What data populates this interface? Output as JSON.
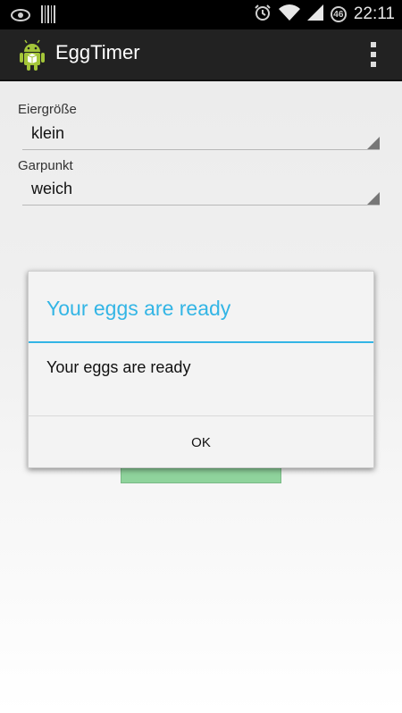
{
  "status_bar": {
    "time": "22:11",
    "network_badge": "46",
    "icons": [
      "eye-icon",
      "barcode-icon",
      "alarm-icon",
      "wifi-icon",
      "signal-icon"
    ]
  },
  "action_bar": {
    "title": "EggTimer",
    "app_icon": "android-robot-icon",
    "overflow_icon": "overflow-menu-icon"
  },
  "form": {
    "size_label": "Eiergröße",
    "size_value": "klein",
    "doneness_label": "Garpunkt",
    "doneness_value": "weich"
  },
  "dialog": {
    "title": "Your eggs are ready",
    "message": "Your eggs are ready",
    "ok_label": "OK"
  },
  "colors": {
    "accent": "#33b5e5",
    "action_bar": "#222222",
    "start_button": "#8fd39c"
  }
}
